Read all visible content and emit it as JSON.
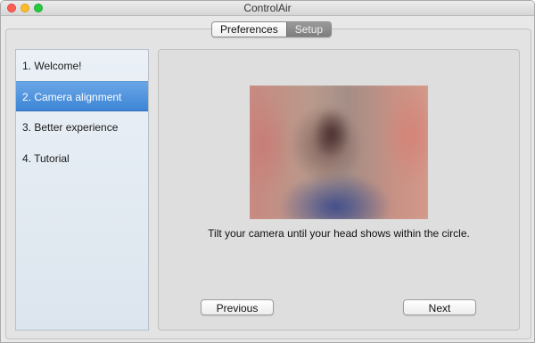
{
  "window": {
    "title": "ControlAir"
  },
  "tabs": [
    {
      "label": "Preferences",
      "active": false
    },
    {
      "label": "Setup",
      "active": true
    }
  ],
  "sidebar": {
    "items": [
      {
        "label": "1. Welcome!",
        "selected": false
      },
      {
        "label": "2. Camera alignment",
        "selected": true
      },
      {
        "label": "3. Better experience",
        "selected": false
      },
      {
        "label": "4. Tutorial",
        "selected": false
      }
    ]
  },
  "main": {
    "instruction": "Tilt your camera until your head shows within the circle.",
    "previous_label": "Previous",
    "next_label": "Next"
  },
  "colors": {
    "selection_blue": "#3d86d6",
    "close": "#fd5f57",
    "minimize": "#fdbc2e",
    "maximize": "#28c840"
  }
}
